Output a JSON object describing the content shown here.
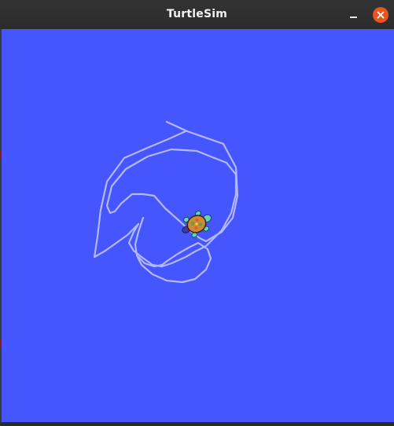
{
  "window": {
    "title": "TurtleSim"
  },
  "titlebar": {
    "minimize_icon": "minimize-icon",
    "close_icon": "close-icon",
    "close_color": "#e95420"
  },
  "canvas": {
    "background_color": "#4556ff",
    "pen_color": "#b3b8ff",
    "turtle_icon": "turtle-icon"
  }
}
